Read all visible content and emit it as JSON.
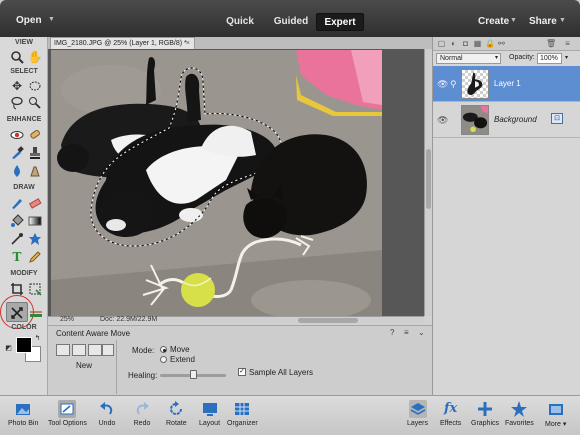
{
  "colors": {
    "accent_blue": "#2a6fc0",
    "selected_layer": "#5d8ed1",
    "marquee_red": "#d0332a"
  },
  "topbar": {
    "open_label": "Open",
    "modes": [
      {
        "label": "Quick",
        "active": false
      },
      {
        "label": "Guided",
        "active": false
      },
      {
        "label": "Expert",
        "active": true
      }
    ],
    "create_label": "Create",
    "share_label": "Share"
  },
  "toolbox": {
    "sections": {
      "view": "VIEW",
      "select": "SELECT",
      "enhance": "ENHANCE",
      "draw": "DRAW",
      "modify": "MODIFY",
      "color": "COLOR"
    },
    "selected_tool": "content-aware-move"
  },
  "document": {
    "tab_title": "IMG_2180.JPG @ 25% (Layer 1, RGB/8) *",
    "zoom": "25%",
    "doc_size": "Doc: 22.9M/22.9M"
  },
  "tool_options": {
    "title": "Content Aware Move",
    "new_label": "New",
    "mode_label": "Mode:",
    "mode_options": [
      {
        "label": "Move",
        "selected": true
      },
      {
        "label": "Extend",
        "selected": false
      }
    ],
    "healing_label": "Healing:",
    "healing_value": 0.5,
    "sample_all_label": "Sample All Layers",
    "sample_all_checked": true
  },
  "layers_panel": {
    "blend_mode": "Normal",
    "opacity_label": "Opacity:",
    "opacity_value": "100%",
    "layers": [
      {
        "name": "Layer 1",
        "selected": true,
        "visible": true
      },
      {
        "name": "Background",
        "selected": false,
        "visible": true
      }
    ]
  },
  "taskbar": {
    "left": [
      {
        "label": "Photo Bin",
        "icon": "photo-bin-icon"
      },
      {
        "label": "Tool Options",
        "icon": "tool-options-icon"
      },
      {
        "label": "Undo",
        "icon": "undo-icon"
      },
      {
        "label": "Redo",
        "icon": "redo-icon"
      },
      {
        "label": "Rotate",
        "icon": "rotate-icon"
      },
      {
        "label": "Layout",
        "icon": "layout-icon"
      },
      {
        "label": "Organizer",
        "icon": "organizer-icon"
      }
    ],
    "right": [
      {
        "label": "Layers",
        "icon": "layers-icon"
      },
      {
        "label": "Effects",
        "icon": "fx-icon"
      },
      {
        "label": "Graphics",
        "icon": "graphics-icon"
      },
      {
        "label": "Favorites",
        "icon": "star-icon"
      },
      {
        "label": "More",
        "icon": "more-icon"
      }
    ]
  }
}
